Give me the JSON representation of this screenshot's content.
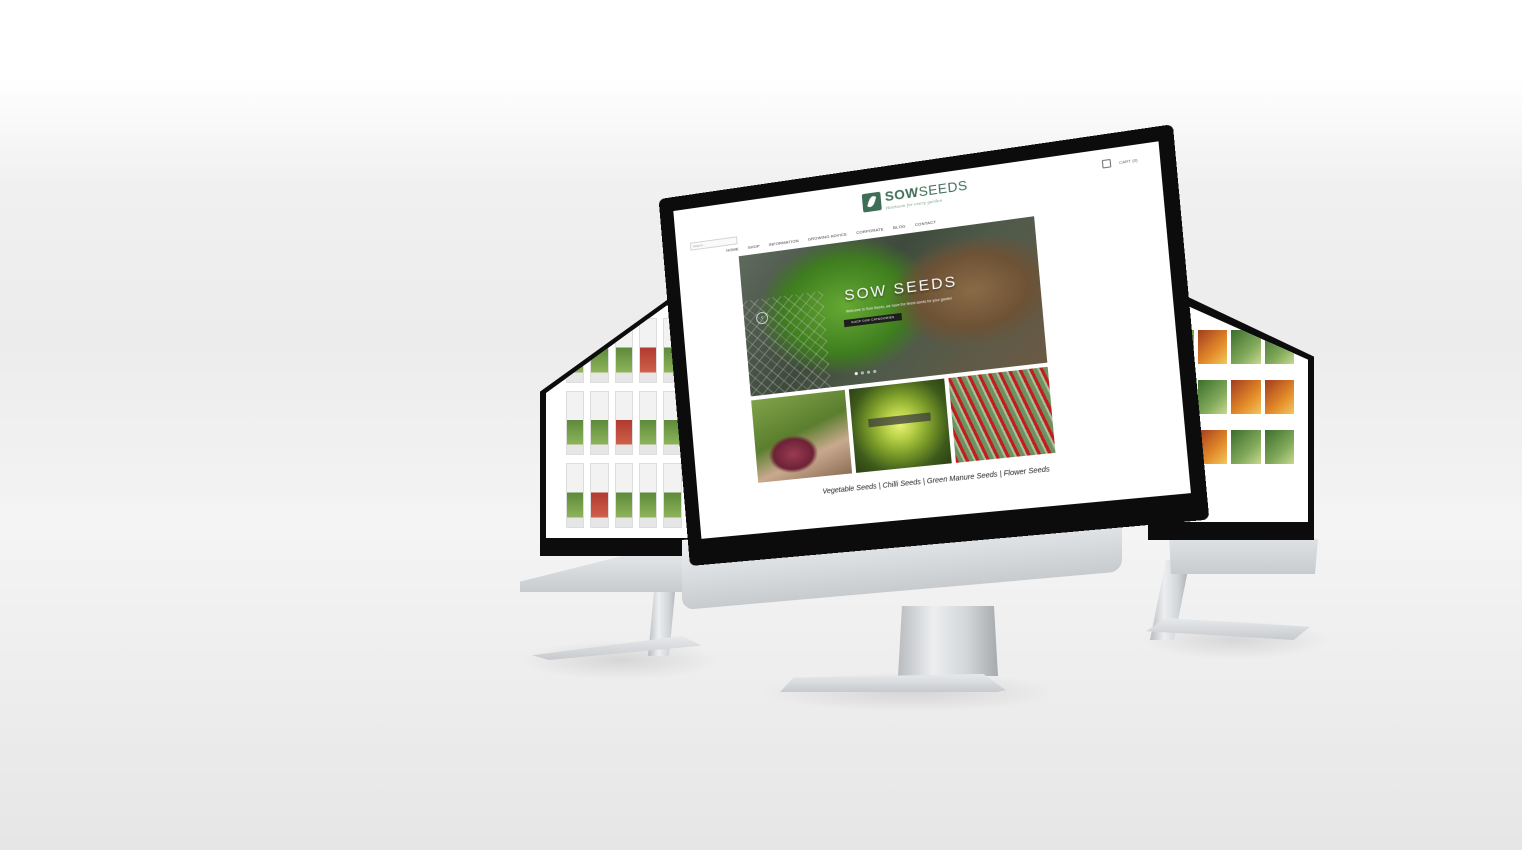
{
  "site": {
    "logo_text_bold": "SOW",
    "logo_text_light": "SEEDS",
    "tagline": "Heirloom for every garden",
    "cart_label": "CART (0)",
    "search_placeholder": "Search...",
    "nav": [
      "HOME",
      "SHOP",
      "INFORMATION",
      "GROWING ADVICE",
      "CORPORATE",
      "BLOG",
      "CONTACT"
    ],
    "hero": {
      "title": "SOW SEEDS",
      "subtitle": "Welcome to Sow Seeds, we have the finest seeds for your garden",
      "button_label": "SHOP OUR CATEGORIES",
      "prev_arrow": "‹"
    },
    "category_links": "Vegetable Seeds | Chilli Seeds | Green Manure Seeds | Flower Seeds"
  },
  "colors": {
    "brand_green": "#3f6e57",
    "bezel": "#0c0c0c",
    "aluminium": "#d9dcdf"
  },
  "icons": [
    "leaf-logo-icon",
    "cart-icon",
    "carousel-prev-icon"
  ]
}
